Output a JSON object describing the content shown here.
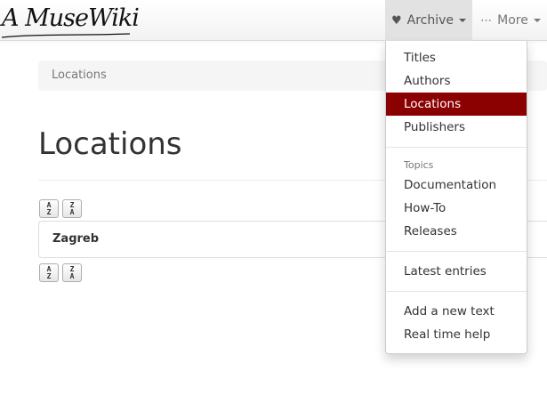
{
  "brand": {
    "logo_text": "A MuseWiki"
  },
  "nav": {
    "archive_label": "Archive",
    "more_label": "More"
  },
  "breadcrumb": {
    "current": "Locations"
  },
  "page": {
    "title": "Locations"
  },
  "sort": {
    "asc_top": "A",
    "asc_bottom": "Z",
    "desc_top": "Z",
    "desc_bottom": "A"
  },
  "locations": [
    {
      "name": "Zagreb"
    }
  ],
  "dropdown": {
    "items": [
      {
        "label": "Titles"
      },
      {
        "label": "Authors"
      },
      {
        "label": "Locations",
        "active": true
      },
      {
        "label": "Publishers"
      }
    ],
    "topics_header": "Topics",
    "topics": [
      {
        "label": "Documentation"
      },
      {
        "label": "How-To"
      },
      {
        "label": "Releases"
      }
    ],
    "latest": {
      "label": "Latest entries"
    },
    "extra": [
      {
        "label": "Add a new text"
      },
      {
        "label": "Real time help"
      }
    ]
  },
  "colors": {
    "active_bg": "#8b0000",
    "nav_active_bg": "#e2e2e2"
  },
  "icons": {
    "archive": "heart-icon",
    "more": "ellipsis-icon",
    "sort_asc": "sort-alpha-asc-icon",
    "sort_desc": "sort-alpha-desc-icon"
  }
}
